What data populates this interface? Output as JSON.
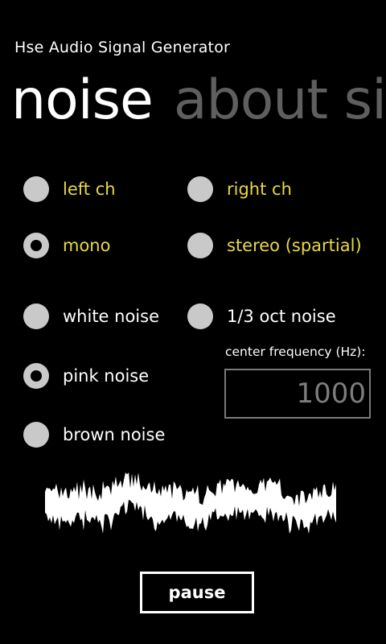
{
  "app": {
    "title": "Hse Audio Signal Generator"
  },
  "pivot": {
    "items": [
      {
        "label": "noise",
        "active": true
      },
      {
        "label": "about si",
        "active": false
      }
    ]
  },
  "channel": {
    "left": {
      "label": "left ch",
      "checked": false
    },
    "right": {
      "label": "right ch",
      "checked": false
    },
    "mono": {
      "label": "mono",
      "checked": true
    },
    "stereo": {
      "label": "stereo (spartial)",
      "checked": false
    }
  },
  "noise_type": {
    "white": {
      "label": "white noise",
      "checked": false
    },
    "oct": {
      "label": "1/3 oct noise",
      "checked": false
    },
    "pink": {
      "label": "pink noise",
      "checked": true
    },
    "brown": {
      "label": "brown noise",
      "checked": false
    }
  },
  "center_frequency": {
    "caption": "center frequency (Hz):",
    "value": "1000"
  },
  "controls": {
    "pause_label": "pause"
  },
  "colors": {
    "accent": "#e8d845",
    "inactive_pivot": "#5f5f5f",
    "radio_fill": "#c9c9c9",
    "background": "#000000"
  }
}
